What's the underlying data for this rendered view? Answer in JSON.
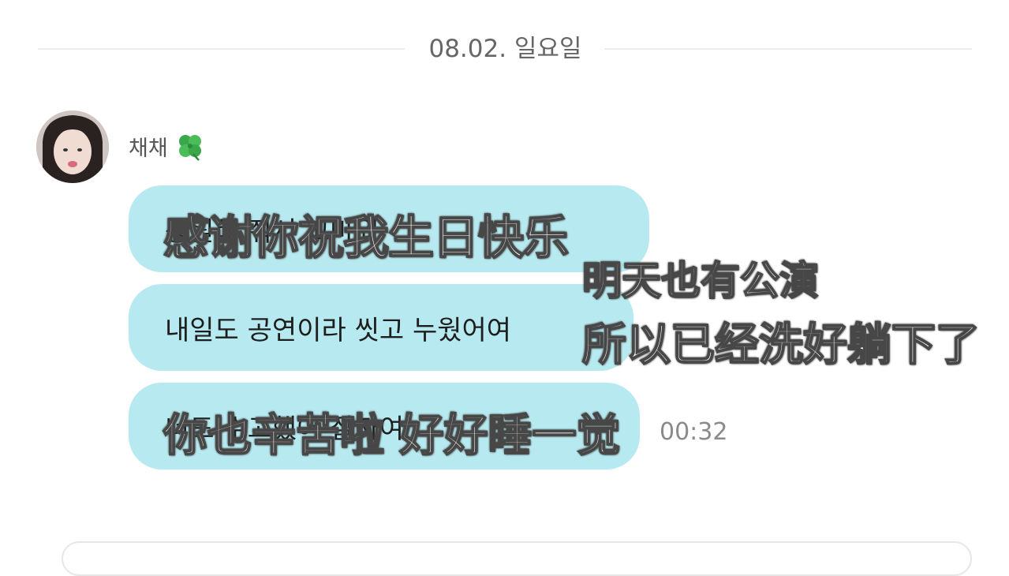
{
  "date_divider": "08.02. 일요일",
  "sender": {
    "name": "채채",
    "badge_icon": "four-leaf-clover-icon"
  },
  "messages": [
    {
      "text": "응원해 줘서 고마워"
    },
    {
      "text": "내일도 공연이라 씻고 누웠어여"
    },
    {
      "text": "너도 수고했어 잘자여",
      "time": "00:32"
    }
  ],
  "subtitles": {
    "line1": "感谢你祝我生日快乐",
    "line2": "明天也有公演",
    "line3": "所以已经洗好躺下了",
    "line4": "你也辛苦啦 好好睡一觉"
  },
  "colors": {
    "bubble": "#b7eaf0",
    "divider": "#ececec",
    "time": "#8a8a8a",
    "subtitle_outline": "#474747"
  }
}
